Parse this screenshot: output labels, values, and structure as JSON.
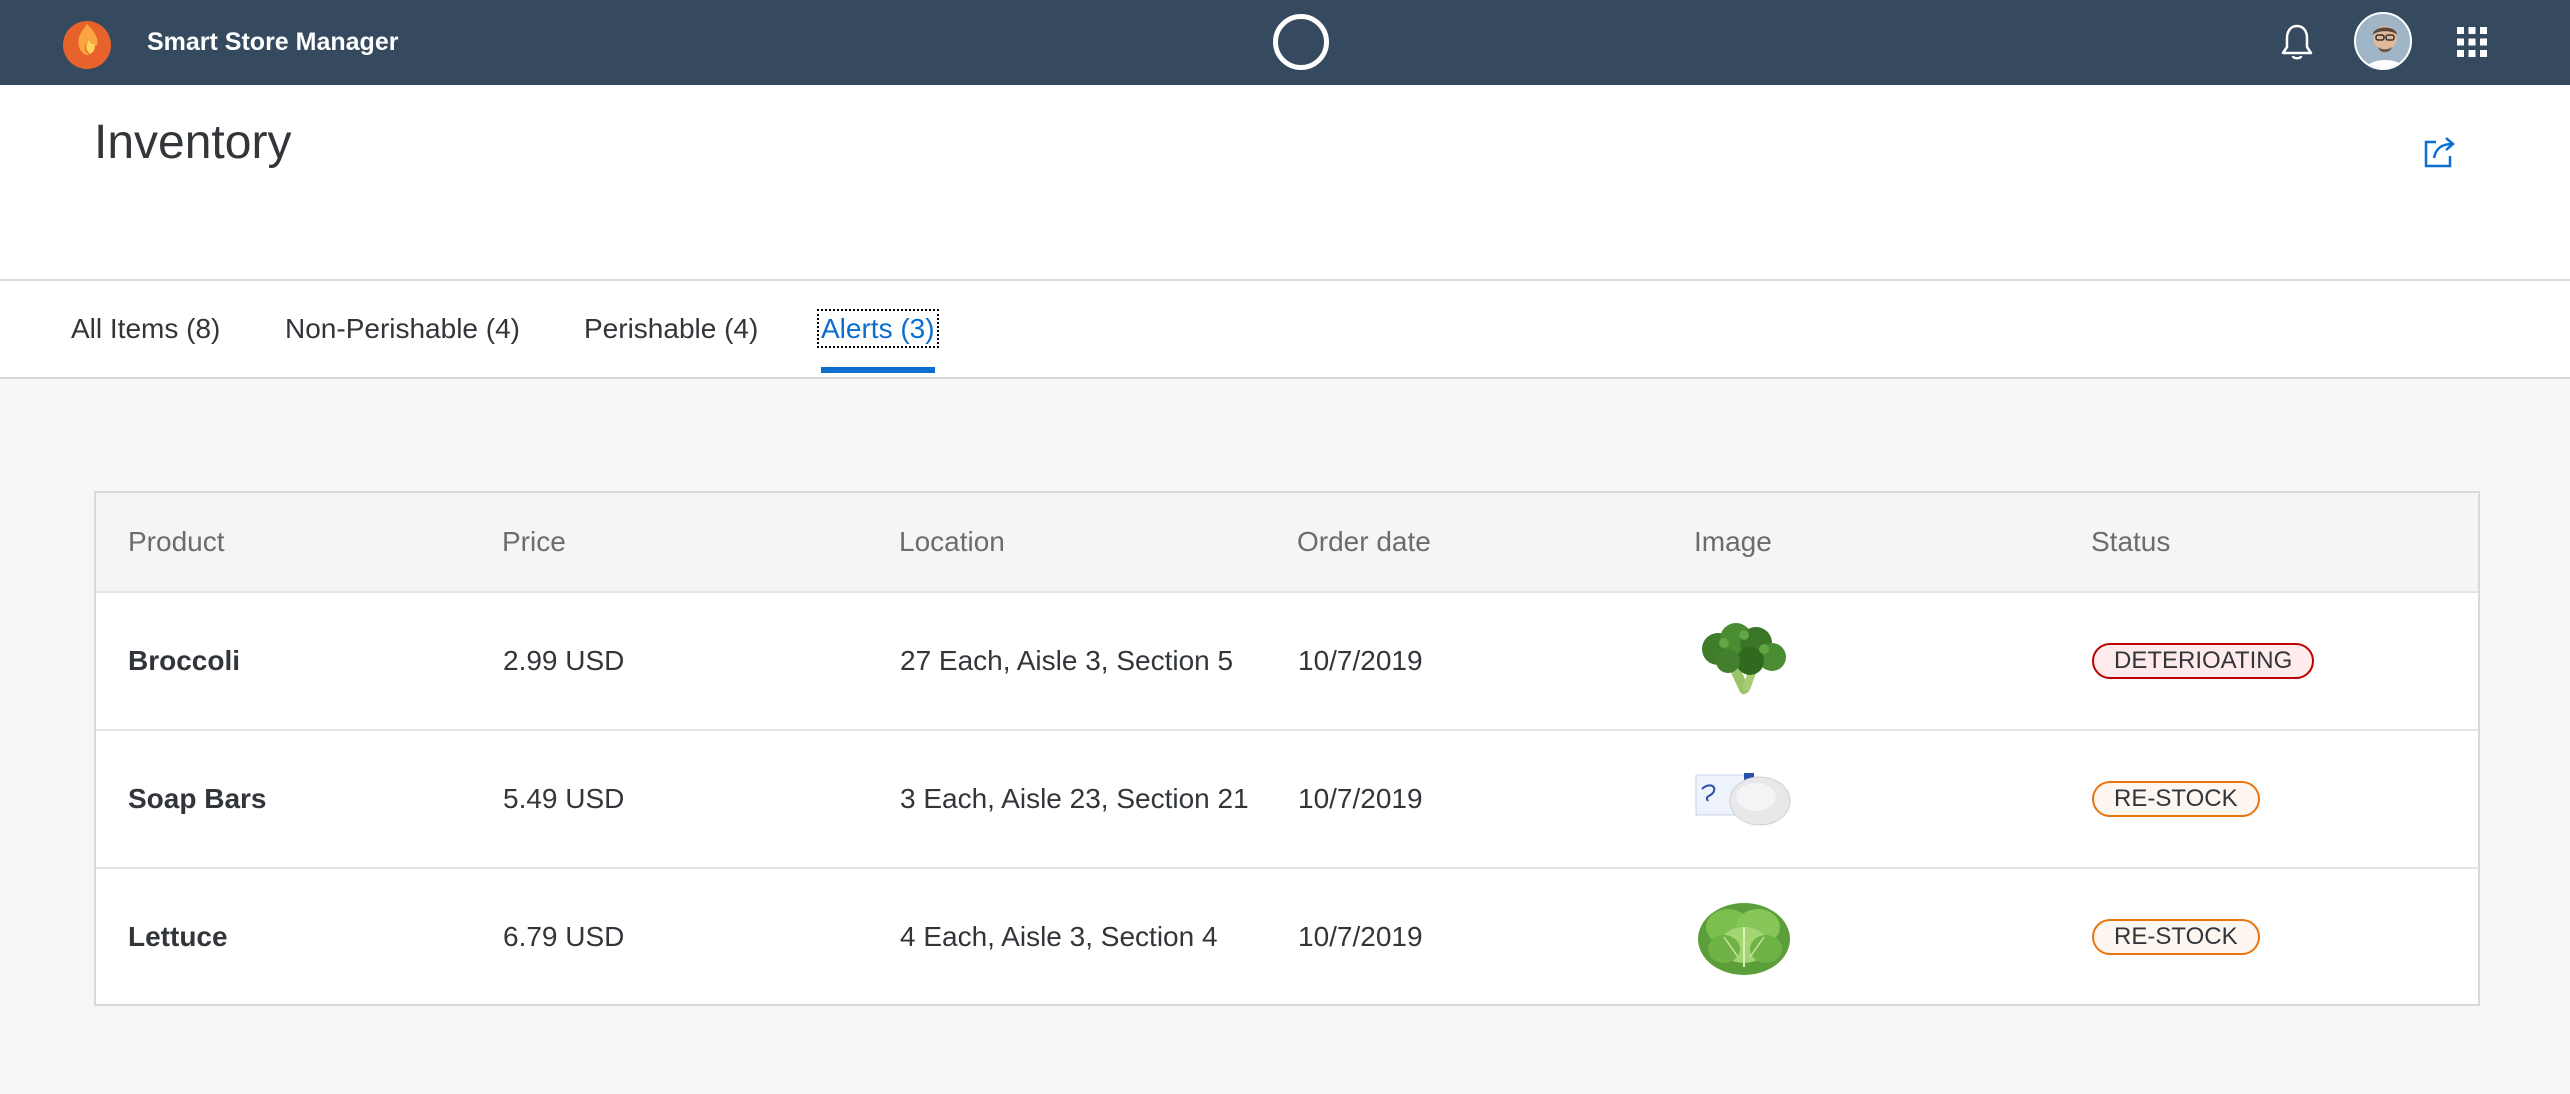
{
  "shell": {
    "title": "Smart Store Manager",
    "icons": [
      "logo",
      "busy-indicator",
      "bell-icon",
      "avatar",
      "app-grid-icon"
    ],
    "colors": {
      "bar": "#354a5f",
      "accent": "#0a6ed1"
    }
  },
  "page": {
    "title": "Inventory",
    "share_icon": "share-icon"
  },
  "tabs": [
    {
      "label": "All Items (8)"
    },
    {
      "label": "Non-Perishable (4)"
    },
    {
      "label": "Perishable (4)"
    },
    {
      "label": "Alerts (3)",
      "selected": true
    }
  ],
  "table": {
    "columns": [
      "Product",
      "Price",
      "Location",
      "Order date",
      "Image",
      "Status"
    ],
    "rows": [
      {
        "product": "Broccoli",
        "price": "2.99 USD",
        "location": "27 Each, Aisle 3, Section 5",
        "order_date": "10/7/2019",
        "image": "broccoli",
        "status": "DETERIOATING",
        "status_state": "error"
      },
      {
        "product": "Soap Bars",
        "price": "5.49 USD",
        "location": "3 Each, Aisle 23, Section 21",
        "order_date": "10/7/2019",
        "image": "soap",
        "status": "RE-STOCK",
        "status_state": "warning"
      },
      {
        "product": "Lettuce",
        "price": "6.79 USD",
        "location": "4 Each, Aisle 3, Section 4",
        "order_date": "10/7/2019",
        "image": "lettuce",
        "status": "RE-STOCK",
        "status_state": "warning"
      }
    ]
  }
}
